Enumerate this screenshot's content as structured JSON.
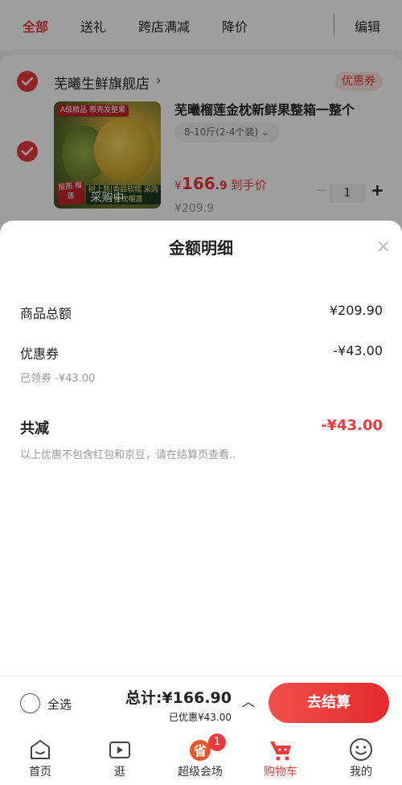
{
  "tabs": [
    {
      "label": "全部"
    },
    {
      "label": "送礼"
    },
    {
      "label": "跨店满减"
    },
    {
      "label": "降价"
    }
  ],
  "edit_label": "编辑",
  "store": {
    "name": "芜曦生鲜旗舰店",
    "arrow": "›",
    "coupon_tag": "优惠券"
  },
  "product": {
    "title": "芜曦榴莲金枕新鲜果整箱一整个",
    "spec": "8-10斤(2-4个装)",
    "spec_arrow": "⌄",
    "image_badge_top": "A级精品 带壳发整果",
    "image_badge_side": "报图 榴莲",
    "image_banner": "树上熟|香甜软糯 采购中 金枕榴莲",
    "image_overlay": "采购中",
    "price_symbol": "¥",
    "price_int": "166",
    "price_dec": ".9",
    "price_note": "到手价",
    "original_price": "¥209.9",
    "quantity": "1",
    "minus": "−",
    "plus": "+"
  },
  "sheet": {
    "title": "金额明细",
    "close": "×",
    "goods_total_label": "商品总额",
    "goods_total_value": "¥209.90",
    "coupon_label": "优惠券",
    "coupon_value": "-¥43.00",
    "coupon_sub": "已领券 -¥43.00",
    "total_reduce_label": "共减",
    "total_reduce_value": "-¥43.00",
    "note": "以上优惠不包含红包和京豆，请在结算页查看.."
  },
  "bottom": {
    "select_all": "全选",
    "total": "总计:¥166.90",
    "saved": "已优惠¥43.00",
    "caret": "︿",
    "checkout": "去结算"
  },
  "nav": [
    {
      "label": "首页",
      "icon": "home-icon"
    },
    {
      "label": "逛",
      "icon": "play-icon"
    },
    {
      "label": "超级会场",
      "icon": "venue-icon",
      "badge": "1",
      "badge_char": "省"
    },
    {
      "label": "购物车",
      "icon": "cart-icon"
    },
    {
      "label": "我的",
      "icon": "profile-icon"
    }
  ],
  "colors": {
    "accent": "#e93b3d",
    "overlay": "rgba(0,0,0,0.38)"
  }
}
